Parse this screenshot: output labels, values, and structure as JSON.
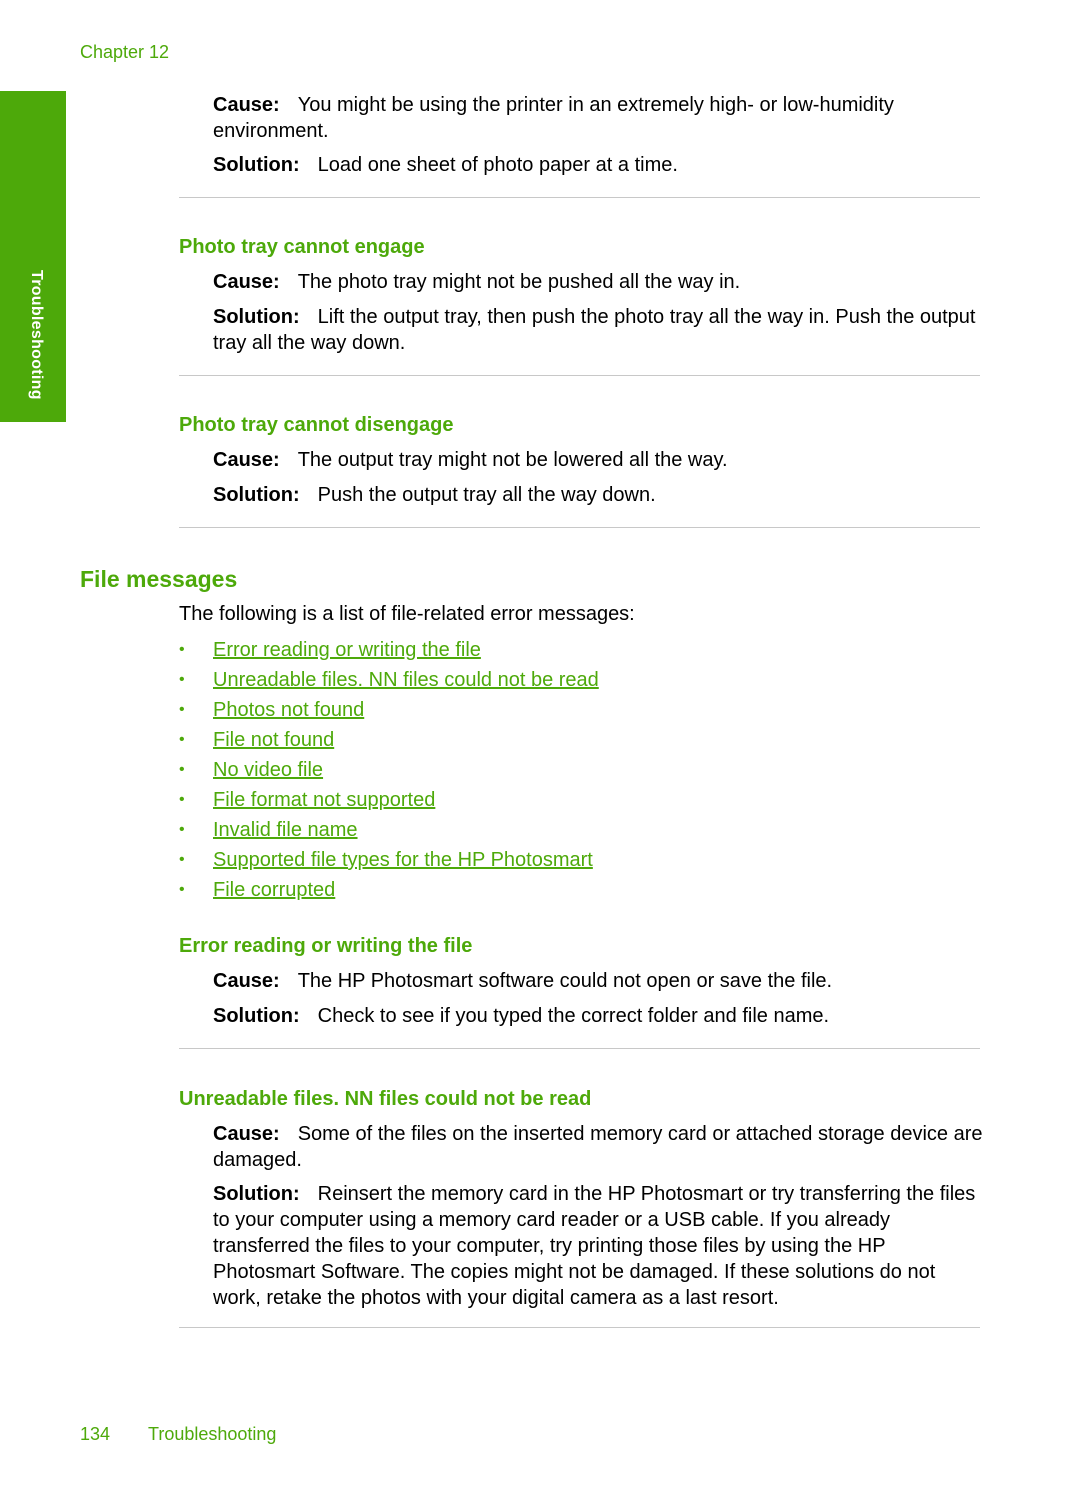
{
  "header": {
    "chapter": "Chapter 12"
  },
  "side_tab": {
    "label": "Troubleshooting"
  },
  "sections": {
    "top": {
      "cause_label": "Cause:",
      "cause_text": "You might be using the printer in an extremely high- or low-humidity environment.",
      "solution_label": "Solution:",
      "solution_text": "Load one sheet of photo paper at a time."
    },
    "engage": {
      "title": "Photo tray cannot engage",
      "cause_label": "Cause:",
      "cause_text": "The photo tray might not be pushed all the way in.",
      "solution_label": "Solution:",
      "solution_text": "Lift the output tray, then push the photo tray all the way in. Push the output tray all the way down."
    },
    "disengage": {
      "title": "Photo tray cannot disengage",
      "cause_label": "Cause:",
      "cause_text": "The output tray might not be lowered all the way.",
      "solution_label": "Solution:",
      "solution_text": "Push the output tray all the way down."
    },
    "file_messages": {
      "title": "File messages",
      "intro": "The following is a list of file-related error messages:",
      "links": [
        "Error reading or writing the file",
        "Unreadable files. NN files could not be read",
        "Photos not found",
        "File not found",
        "No video file",
        "File format not supported",
        "Invalid file name",
        "Supported file types for the HP Photosmart",
        "File corrupted"
      ]
    },
    "error_rw": {
      "title": "Error reading or writing the file",
      "cause_label": "Cause:",
      "cause_text": "The HP Photosmart software could not open or save the file.",
      "solution_label": "Solution:",
      "solution_text": "Check to see if you typed the correct folder and file name."
    },
    "unreadable": {
      "title": "Unreadable files. NN files could not be read",
      "cause_label": "Cause:",
      "cause_text": "Some of the files on the inserted memory card or attached storage device are damaged.",
      "solution_label": "Solution:",
      "solution_text": "Reinsert the memory card in the HP Photosmart or try transferring the files to your computer using a memory card reader or a USB cable. If you already transferred the files to your computer, try printing those files by using the HP Photosmart Software. The copies might not be damaged. If these solutions do not work, retake the photos with your digital camera as a last resort."
    }
  },
  "footer": {
    "page_number": "134",
    "section": "Troubleshooting"
  }
}
